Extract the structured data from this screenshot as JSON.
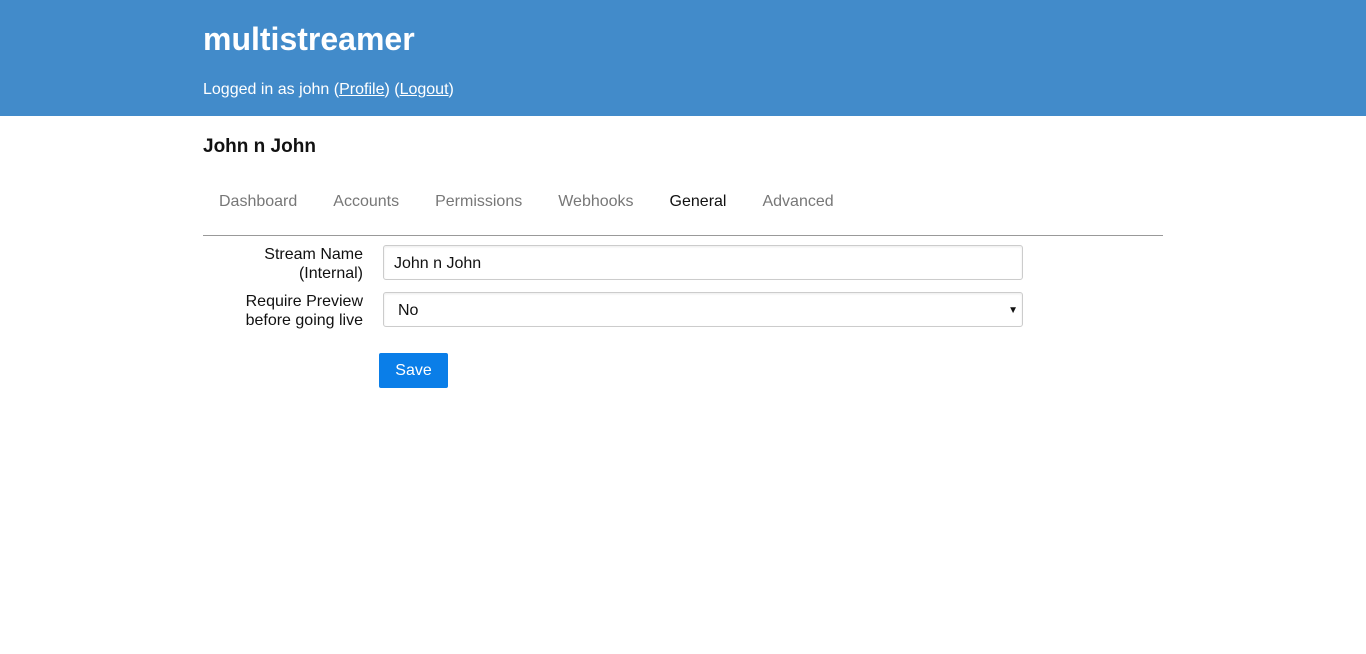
{
  "header": {
    "title": "multistreamer",
    "logged_in_prefix": "Logged in as john (",
    "profile_link": "Profile",
    "between": ") (",
    "logout_link": "Logout",
    "suffix": ")"
  },
  "stream": {
    "title": "John n John"
  },
  "tabs": [
    {
      "label": "Dashboard",
      "active": false
    },
    {
      "label": "Accounts",
      "active": false
    },
    {
      "label": "Permissions",
      "active": false
    },
    {
      "label": "Webhooks",
      "active": false
    },
    {
      "label": "General",
      "active": true
    },
    {
      "label": "Advanced",
      "active": false
    }
  ],
  "form": {
    "stream_name": {
      "label_line1": "Stream Name",
      "label_line2": "(Internal)",
      "value": "John n John"
    },
    "require_preview": {
      "label_line1": "Require Preview",
      "label_line2": "before going live",
      "value": "No"
    },
    "save_label": "Save"
  },
  "colors": {
    "header_bg": "#428bca",
    "save_bg": "#0a7ee8"
  }
}
